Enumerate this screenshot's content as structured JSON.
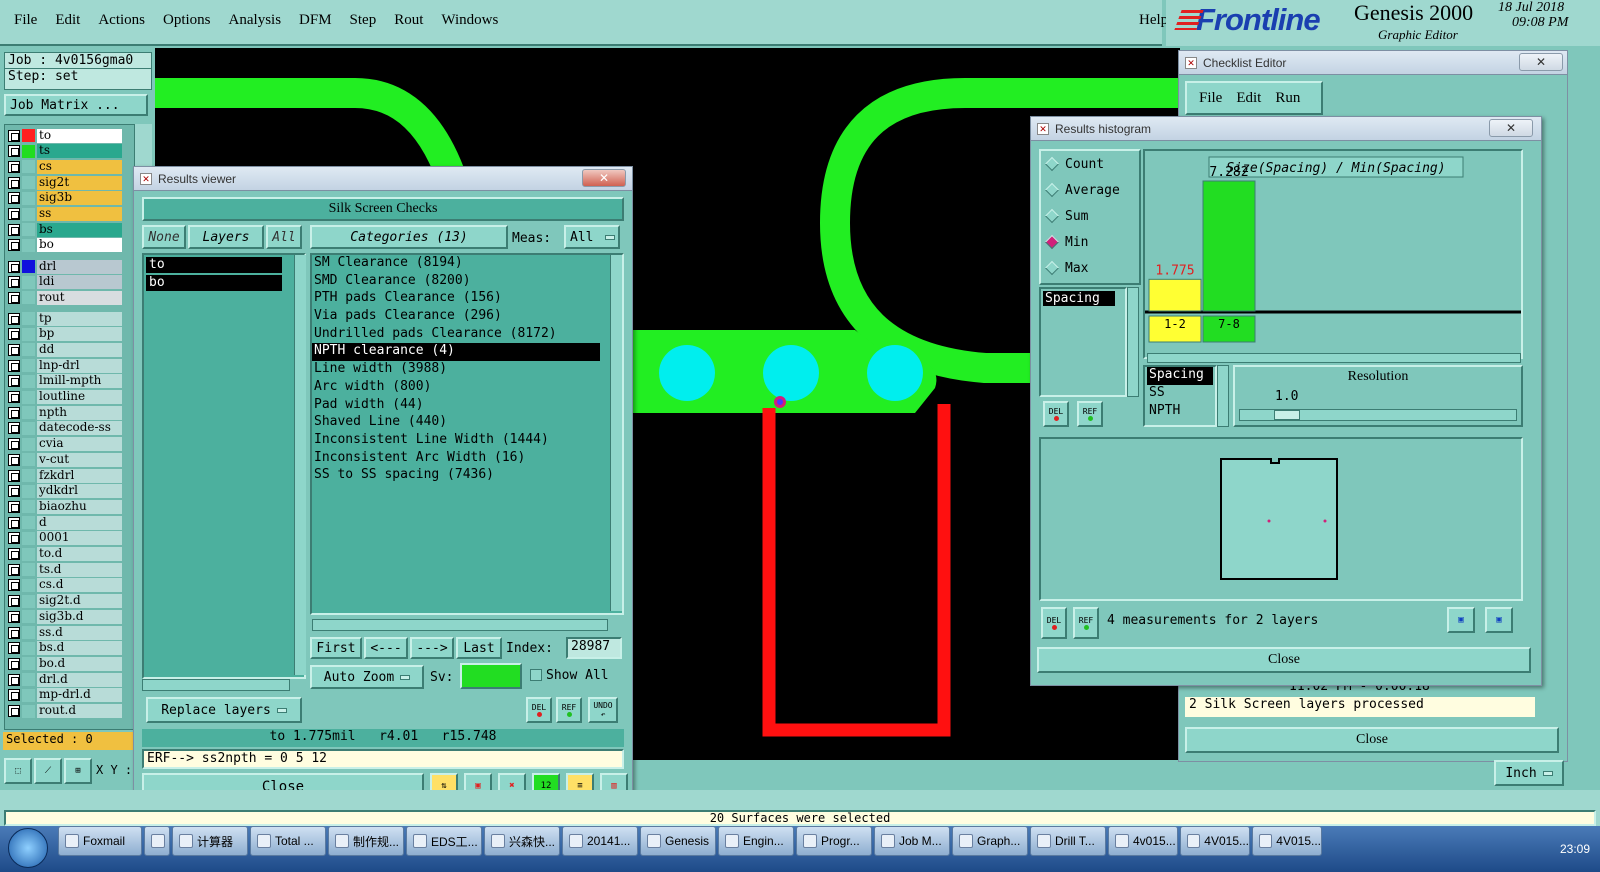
{
  "menu": [
    "File",
    "Edit",
    "Actions",
    "Options",
    "Analysis",
    "DFM",
    "Step",
    "Rout",
    "Windows"
  ],
  "help": "Help",
  "brand": {
    "logo": "Frontline",
    "product": "Genesis 2000",
    "subtitle": "Graphic Editor",
    "date": "18 Jul 2018",
    "time": "09:08 PM"
  },
  "job": {
    "job": "Job : 4v0156gma0",
    "step": "Step: set",
    "matrix_btn": "Job Matrix ..."
  },
  "layers_a": [
    {
      "name": "to",
      "color": "#ff2020",
      "bg": "#ffffff"
    },
    {
      "name": "ts",
      "color": "#20dd20",
      "bg": "#2aa88e"
    },
    {
      "name": "cs",
      "color": "",
      "bg": "#f0c040"
    },
    {
      "name": "sig2t",
      "color": "",
      "bg": "#f0c040"
    },
    {
      "name": "sig3b",
      "color": "",
      "bg": "#f0c040"
    },
    {
      "name": "ss",
      "color": "",
      "bg": "#f0c040"
    },
    {
      "name": "bs",
      "color": "",
      "bg": "#2aa88e"
    },
    {
      "name": "bo",
      "color": "",
      "bg": "#ffffff"
    }
  ],
  "layers_b": [
    {
      "name": "drl",
      "color": "#1010dd",
      "bg": "#b8c8d0"
    },
    {
      "name": "ldi",
      "color": "",
      "bg": "#b8c8d0"
    },
    {
      "name": "rout",
      "color": "",
      "bg": "#d8dde0"
    }
  ],
  "layers_c": [
    "tp",
    "bp",
    "dd",
    "lnp-drl",
    "lmill-mpth",
    "loutline",
    "npth",
    "datecode-ss",
    "cvia",
    "v-cut",
    "fzkdrl",
    "ydkdrl",
    "biaozhu",
    "d",
    "0001",
    "to.d",
    "ts.d",
    "cs.d",
    "sig2t.d",
    "sig3b.d",
    "ss.d",
    "bs.d",
    "bo.d",
    "drl.d",
    "mp-drl.d",
    "rout.d"
  ],
  "selected": "Selected : 0",
  "xy": "X Y :",
  "results_viewer": {
    "title": "Results viewer",
    "heading": "Silk Screen Checks",
    "none_btn": "None",
    "layers_btn": "Layers",
    "all_btn": "All",
    "categories_btn": "Categories (13)",
    "meas_label": "Meas:",
    "meas_value": "All",
    "layer_list": [
      "to",
      "bo"
    ],
    "categories": [
      "SM Clearance (8194)",
      "SMD Clearance (8200)",
      "PTH pads Clearance (156)",
      "Via pads Clearance (296)",
      "Undrilled pads Clearance (8172)",
      "NPTH clearance (4)",
      "Line width (3988)",
      "Arc width (800)",
      "Pad width (44)",
      "Shaved Line (440)",
      "Inconsistent Line Width (1444)",
      "Inconsistent Arc Width (16)",
      "SS to SS spacing (7436)"
    ],
    "selected_category": "NPTH clearance (4)",
    "first_btn": "First",
    "prev_btn": "<---",
    "next_btn": "--->",
    "last_btn": "Last",
    "index_label": "Index:",
    "index_value": "28987",
    "auto_zoom": "Auto Zoom",
    "sv_label": "Sv:",
    "show_all": "Show All",
    "replace_layers": "Replace layers",
    "del": "DEL",
    "ref": "REF",
    "undo": "UNDO",
    "status": "to 1.775mil   r4.01   r15.748",
    "erf": "ERF--> ss2npth = 0 5 12",
    "close": "Close"
  },
  "checklist_editor": {
    "title": "Checklist Editor",
    "menu": [
      "File",
      "Edit",
      "Run"
    ],
    "time_row": "11:02 PM - 0:00:18",
    "processed": "2 Silk Screen layers processed",
    "close": "Close",
    "units": "Inch"
  },
  "histogram": {
    "title": "Results histogram",
    "modes": [
      "Count",
      "Average",
      "Sum",
      "Min",
      "Max"
    ],
    "selected_mode": "Min",
    "chart_title": "Size(Spacing) / Min(Spacing)",
    "list_top": [
      "Spacing"
    ],
    "list_bottom": [
      "Spacing",
      "SS",
      "NPTH"
    ],
    "resolution_label": "Resolution",
    "resolution_value": "1.0",
    "del": "DEL",
    "ref": "REF",
    "measurements": "4 measurements for 2 layers",
    "close": "Close"
  },
  "chart_data": {
    "type": "bar",
    "title": "Size(Spacing) / Min(Spacing)",
    "categories": [
      "1-2",
      "7-8"
    ],
    "values": [
      1.775,
      7.282
    ],
    "colors": [
      "#ffff33",
      "#22dd22"
    ]
  },
  "status_bar": "20 Surfaces were selected",
  "taskbar": {
    "items": [
      "Foxmail",
      "",
      "计算器",
      "Total ...",
      "制作规...",
      "EDS工...",
      "兴森快...",
      "20141...",
      "Genesis",
      "Engin...",
      "Progr...",
      "Job M...",
      "Graph...",
      "Drill T...",
      "4v015...",
      "4V015...",
      "4V015..."
    ],
    "clock": "23:09"
  },
  "colors": {
    "panel": "#7fc7bb",
    "button": "#8ed6ca",
    "graphics_bg": "#000000",
    "trace": "#22ee22",
    "pad": "#00eeee",
    "rout": "#ff1010"
  }
}
